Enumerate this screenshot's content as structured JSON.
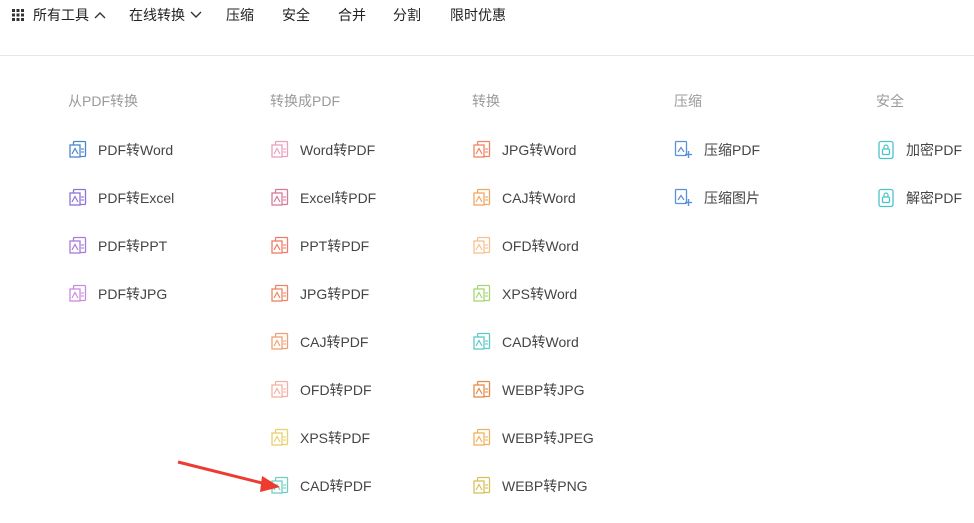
{
  "nav": {
    "all_tools": "所有工具",
    "online_convert": "在线转换",
    "compress": "压缩",
    "security": "安全",
    "merge": "合并",
    "split": "分割",
    "promo": "限时优惠"
  },
  "columns": [
    {
      "title": "从PDF转换",
      "items": [
        {
          "label": "PDF转Word",
          "color": "#4a86cf"
        },
        {
          "label": "PDF转Excel",
          "color": "#8b73d9"
        },
        {
          "label": "PDF转PPT",
          "color": "#a77bd6"
        },
        {
          "label": "PDF转JPG",
          "color": "#c98be0"
        }
      ]
    },
    {
      "title": "转换成PDF",
      "items": [
        {
          "label": "Word转PDF",
          "color": "#e9a0bf"
        },
        {
          "label": "Excel转PDF",
          "color": "#d8789a"
        },
        {
          "label": "PPT转PDF",
          "color": "#ef7b68"
        },
        {
          "label": "JPG转PDF",
          "color": "#ee8460"
        },
        {
          "label": "CAJ转PDF",
          "color": "#f0a070"
        },
        {
          "label": "OFD转PDF",
          "color": "#f2b0a4"
        },
        {
          "label": "XPS转PDF",
          "color": "#e8d06a"
        },
        {
          "label": "CAD转PDF",
          "color": "#6ecfc0"
        }
      ]
    },
    {
      "title": "转换",
      "items": [
        {
          "label": "JPG转Word",
          "color": "#ee8460"
        },
        {
          "label": "CAJ转Word",
          "color": "#f0a762"
        },
        {
          "label": "OFD转Word",
          "color": "#f6c18e"
        },
        {
          "label": "XPS转Word",
          "color": "#a6d673"
        },
        {
          "label": "CAD转Word",
          "color": "#5ec8c6"
        },
        {
          "label": "WEBP转JPG",
          "color": "#e08c4a"
        },
        {
          "label": "WEBP转JPEG",
          "color": "#eeb25f"
        },
        {
          "label": "WEBP转PNG",
          "color": "#d8c05a"
        }
      ]
    },
    {
      "title": "压缩",
      "items": [
        {
          "label": "压缩PDF",
          "color": "#5b8fd8"
        },
        {
          "label": "压缩图片",
          "color": "#5b8fd8"
        }
      ]
    },
    {
      "title": "安全",
      "items": [
        {
          "label": "加密PDF",
          "color": "#4cc3c9"
        },
        {
          "label": "解密PDF",
          "color": "#4cc3c9"
        }
      ]
    }
  ],
  "annotation_color": "#ee3b30"
}
